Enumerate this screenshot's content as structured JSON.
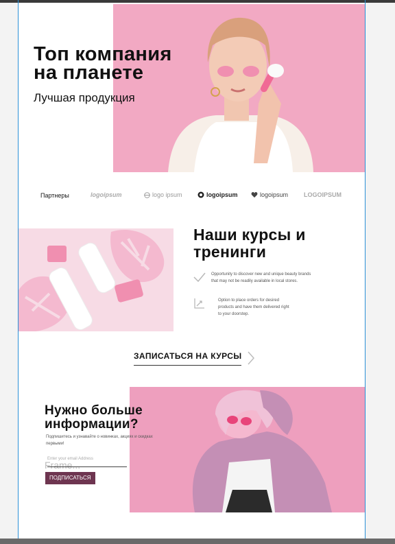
{
  "hero": {
    "title_line1": "Топ компания",
    "title_line2": "на планете",
    "subtitle": "Лучшая продукция"
  },
  "partners": {
    "label": "Партнеры",
    "logos": [
      "logoipsum",
      "logo ipsum",
      "logoipsum",
      "logoipsum",
      "LOGOIPSUM"
    ]
  },
  "courses": {
    "title_line1": "Наши курсы и",
    "title_line2": "тренинги",
    "features": [
      {
        "icon": "check-icon",
        "text_line1": "Opportunity to discover new and unique beauty brands",
        "text_line2": "that may not be readily available in local stores."
      },
      {
        "icon": "chart-arrow-icon",
        "text_line1": "Option to place orders for desired",
        "text_line2": "products and have them delivered right",
        "text_line3": "to your doorstep."
      }
    ],
    "cta_label": "ЗАПИСАТЬСЯ НА КУРСЫ"
  },
  "newsletter": {
    "title_line1": "Нужно больше",
    "title_line2": "информации?",
    "description": "Подпишитесь и узнавайте о новинках, акциях и скидках первыми!",
    "email_placeholder": "Enter your email Address",
    "frame_text": "Frame...",
    "subscribe_label": "ПОДПИСАТЬСЯ"
  },
  "colors": {
    "accent_pink": "#f2a9c3",
    "button_plum": "#6e3550",
    "guide_blue": "#2a8fd6"
  }
}
